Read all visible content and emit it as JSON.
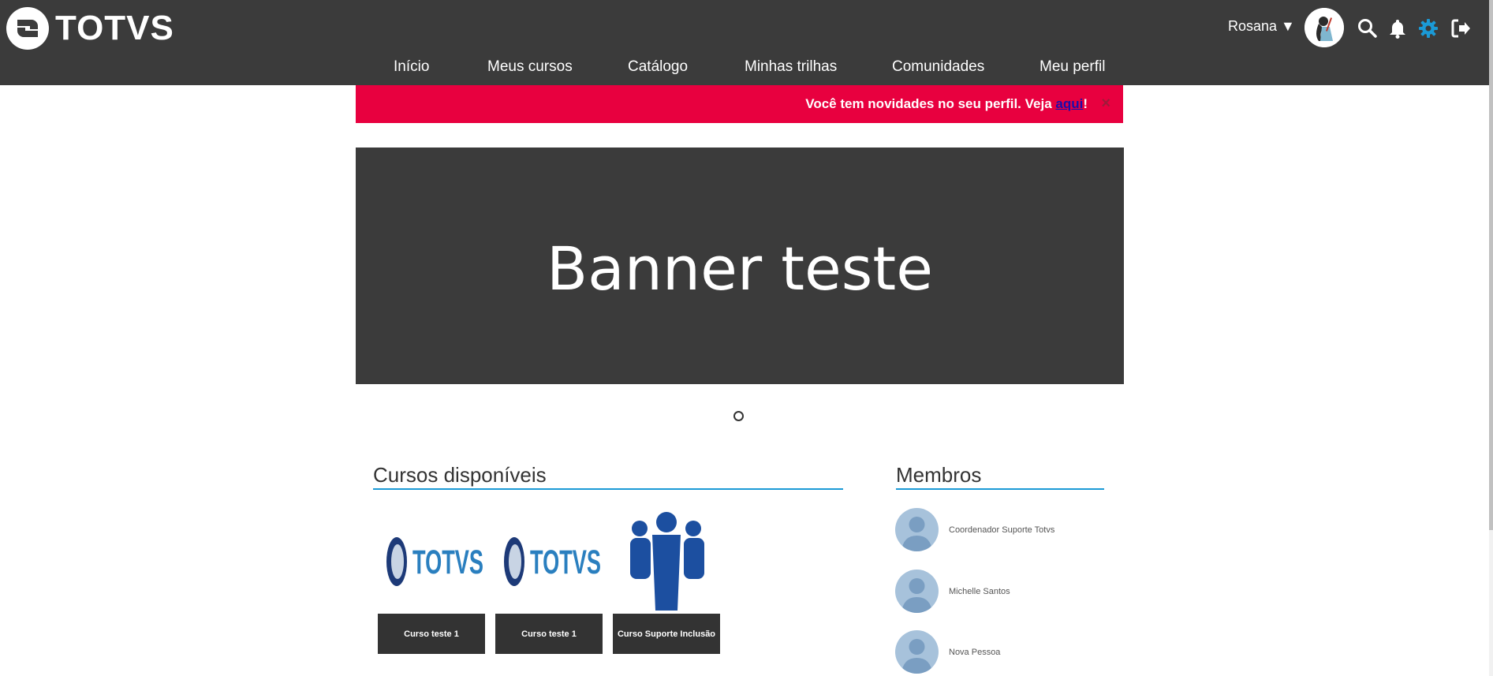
{
  "header": {
    "brand": "TOTVS",
    "user_name": "Rosana ▼",
    "nav": [
      "Início",
      "Meus cursos",
      "Catálogo",
      "Minhas trilhas",
      "Comunidades",
      "Meu perfil"
    ],
    "icons": [
      "search-icon",
      "bell-icon",
      "gear-icon",
      "logout-icon"
    ],
    "accent_color": "#1b9ad6"
  },
  "alert": {
    "message": "Você tem novidades no seu perfil. Veja ",
    "link_text": "aqui",
    "suffix": "!",
    "close": "×",
    "color": "#e8003f"
  },
  "banner": {
    "text": "Banner teste"
  },
  "courses": {
    "title": "Cursos disponíveis",
    "items": [
      {
        "label": "Curso teste 1",
        "thumb_brand": "TOTVS"
      },
      {
        "label": "Curso teste 1",
        "thumb_brand": "TOTVS"
      },
      {
        "label": "Curso Suporte Inclusão"
      }
    ]
  },
  "members": {
    "title": "Membros",
    "items": [
      "Coordenador Suporte Totvs",
      "Michelle Santos",
      "Nova Pessoa"
    ]
  }
}
